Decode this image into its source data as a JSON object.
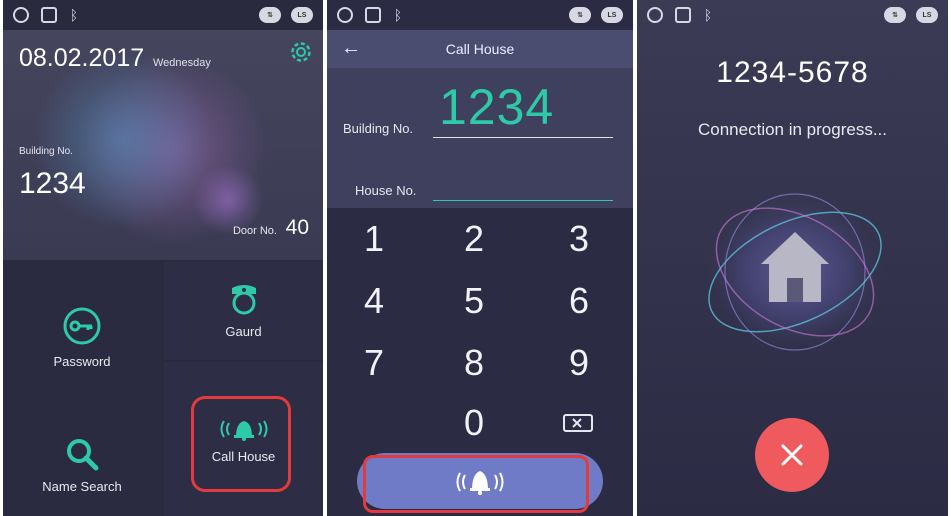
{
  "panel1": {
    "date": "08.02.2017",
    "weekday": "Wednesday",
    "building_label": "Building No.",
    "building_value": "1234",
    "door_label": "Door No.",
    "door_value": "40",
    "tiles": {
      "password": "Password",
      "gaurd": "Gaurd",
      "name_search": "Name Search",
      "call_house": "Call House"
    },
    "status_pills": [
      "LS"
    ]
  },
  "panel2": {
    "title": "Call House",
    "building_label": "Building No.",
    "building_value": "1234",
    "house_label": "House No.",
    "house_value": "",
    "keys": [
      "1",
      "2",
      "3",
      "4",
      "5",
      "6",
      "7",
      "8",
      "9",
      "0"
    ],
    "status_pills": [
      "LS"
    ]
  },
  "panel3": {
    "number": "1234-5678",
    "status": "Connection in progress...",
    "status_pills": [
      "LS"
    ]
  },
  "colors": {
    "accent_teal": "#2ec9a9",
    "call_bar": "#6f7bc7",
    "hangup_red": "#ee5a5e",
    "highlight_outline": "#e33b3b"
  }
}
